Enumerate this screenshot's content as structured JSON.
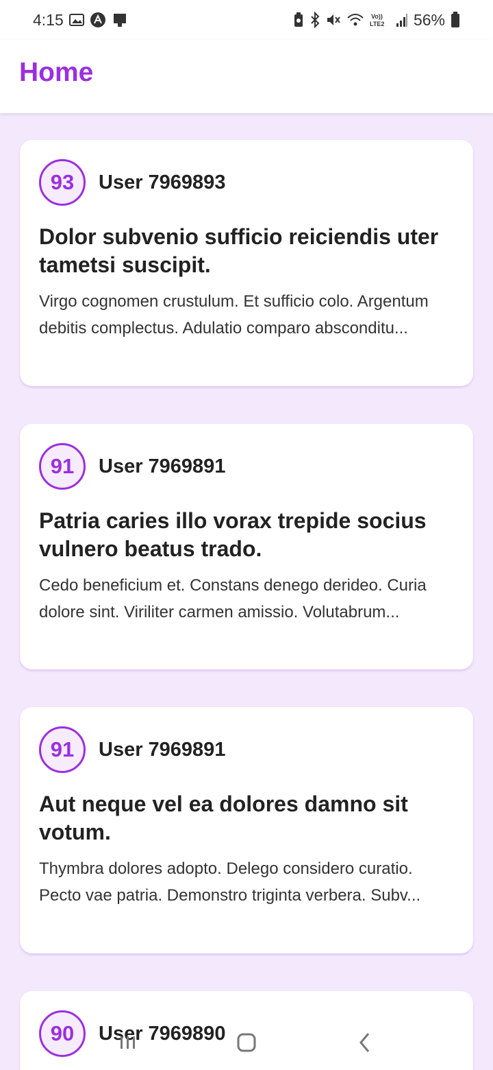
{
  "status_bar": {
    "time": "4:15",
    "battery": "56%",
    "left_icons": [
      "image-icon",
      "app-a-icon",
      "device-icon"
    ],
    "right_icons": [
      "battery-saver-icon",
      "bluetooth-icon",
      "mute-icon",
      "wifi-icon",
      "volte-icon",
      "signal-icon",
      "battery-icon"
    ]
  },
  "app_bar": {
    "title": "Home"
  },
  "posts": [
    {
      "score": "93",
      "user": "User 7969893",
      "title": "Dolor subvenio sufficio reiciendis uter tametsi suscipit.",
      "body": "Virgo cognomen crustulum. Et sufficio colo. Argentum debitis complectus. Adulatio comparo absconditu..."
    },
    {
      "score": "91",
      "user": "User 7969891",
      "title": "Patria caries illo vorax trepide socius vulnero beatus trado.",
      "body": "Cedo beneficium et. Constans denego derideo. Curia dolore sint. Viriliter carmen amissio. Volutabrum..."
    },
    {
      "score": "91",
      "user": "User 7969891",
      "title": "Aut neque vel ea dolores damno sit votum.",
      "body": "Thymbra dolores adopto. Delego considero curatio. Pecto vae patria. Demonstro triginta verbera. Subv..."
    },
    {
      "score": "90",
      "user": "User 7969890",
      "title": "",
      "body": ""
    }
  ],
  "nav_bar": {
    "buttons": [
      "recents-icon",
      "home-icon",
      "back-icon"
    ]
  },
  "colors": {
    "accent": "#9b2fe0",
    "background": "#f4e9fc",
    "card": "#ffffff"
  }
}
